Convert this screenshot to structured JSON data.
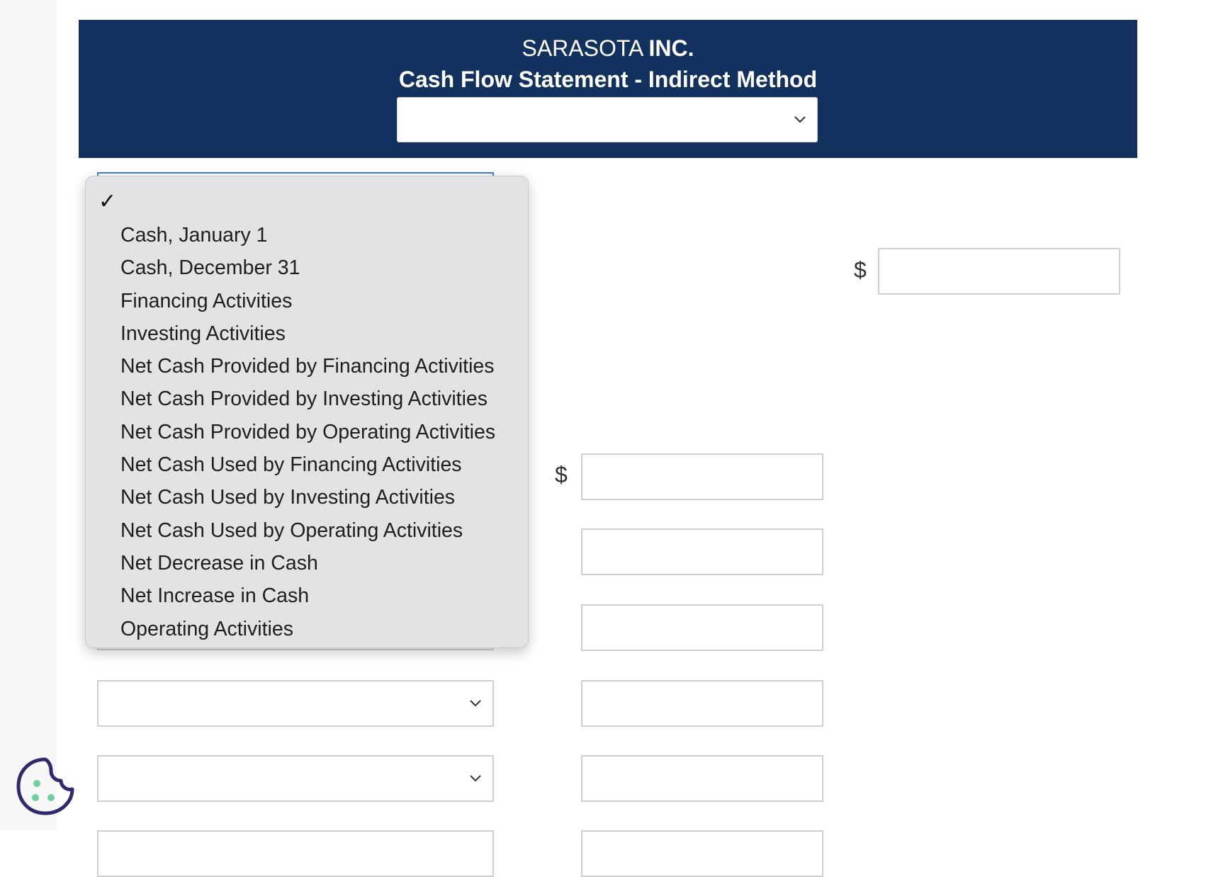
{
  "header": {
    "company_name": "SARASOTA",
    "company_suffix": "INC.",
    "statement_title": "Cash Flow Statement - Indirect Method",
    "period_select_value": ""
  },
  "currency_symbol": "$",
  "dropdown": {
    "selected_option": "",
    "options": [
      "Cash, January 1",
      "Cash, December 31",
      "Financing Activities",
      "Investing Activities",
      "Net Cash Provided by Financing Activities",
      "Net Cash Provided by Investing Activities",
      "Net Cash Provided by Operating Activities",
      "Net Cash Used by Financing Activities",
      "Net Cash Used by Investing Activities",
      "Net Cash Used by Operating Activities",
      "Net Decrease in Cash",
      "Net Increase in Cash",
      "Operating Activities"
    ]
  },
  "inputs": {
    "net_income_amount": "",
    "adjustment_amounts": [
      "",
      "",
      "",
      "",
      "",
      ""
    ]
  },
  "colors": {
    "header_bg": "#13315e",
    "dropdown_bg": "#e3e3e5",
    "cookie_icon": "#2e2a6b",
    "cookie_dots": "#6ccf9c"
  }
}
